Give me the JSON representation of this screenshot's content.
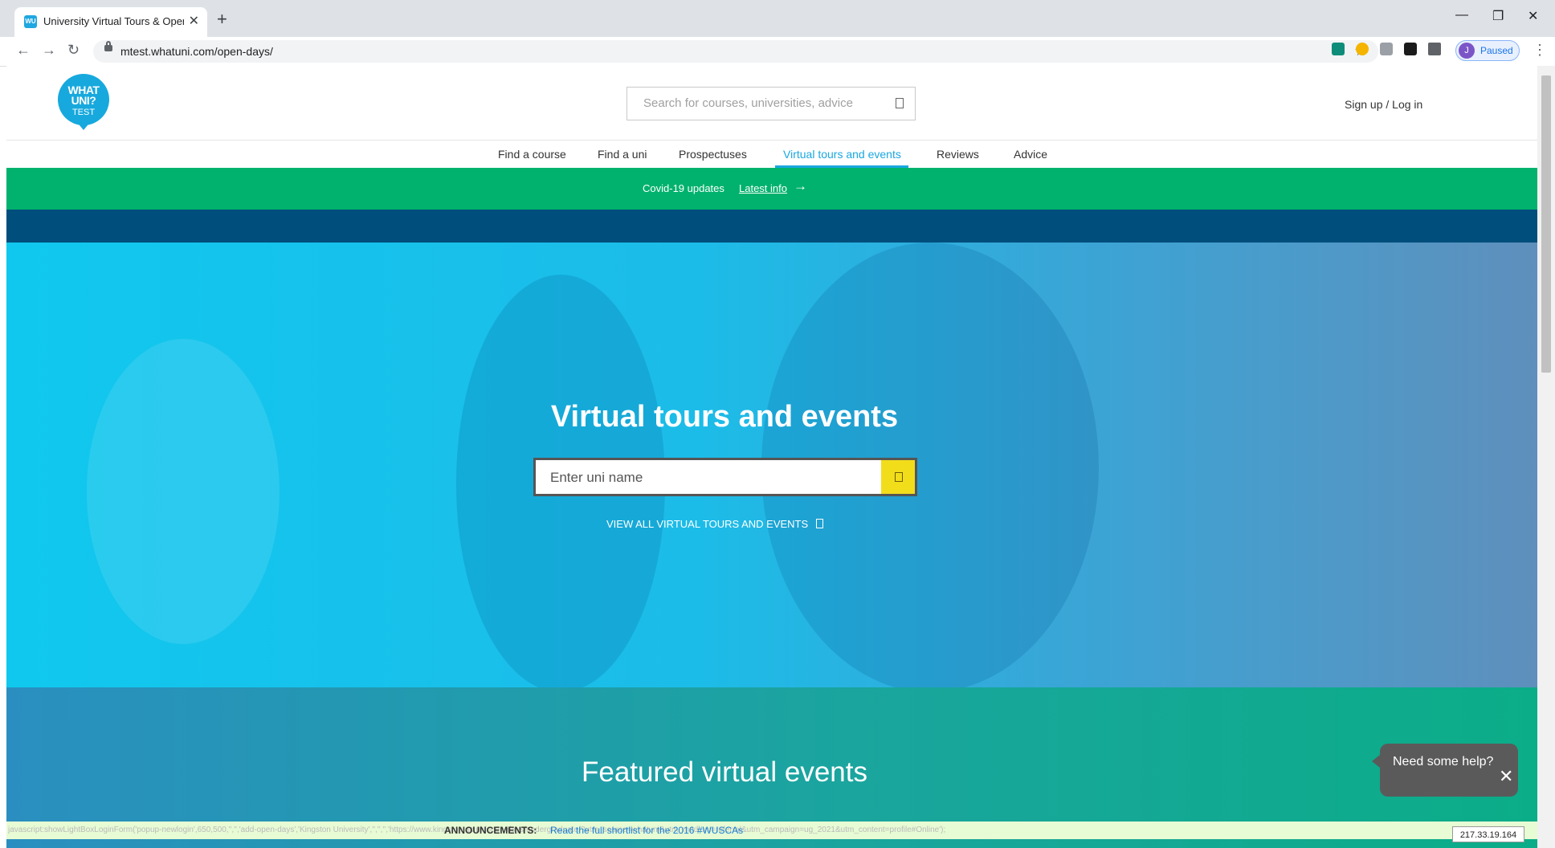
{
  "browser": {
    "tab_title": "University Virtual Tours & Open Days",
    "favicon_text": "WU",
    "url": "mtest.whatuni.com/open-days/",
    "profile_initial": "J",
    "profile_status": "Paused"
  },
  "header": {
    "logo_line1": "WHAT",
    "logo_line2": "UNI?",
    "logo_line3": "TEST",
    "search_placeholder": "Search for courses, universities, advice",
    "signin": "Sign up / Log in"
  },
  "nav": {
    "items": [
      "Find a course",
      "Find a uni",
      "Prospectuses",
      "Virtual tours and events",
      "Reviews",
      "Advice"
    ]
  },
  "covid": {
    "text": "Covid-19 updates",
    "link": "Latest info"
  },
  "hero": {
    "title": "Virtual tours and events",
    "search_placeholder": "Enter uni name",
    "view_all": "VIEW ALL VIRTUAL TOURS AND EVENTS"
  },
  "featured": {
    "title": "Featured virtual events"
  },
  "help": {
    "label": "Need some help?"
  },
  "announcement": {
    "status_url": "javascript:showLightBoxLoginForm('popup-newlogin',650,500,'','','add-open-days','Kingston University','','','','https://www.kingston.ac.uk/open-days/undergraduate/?utm_source=whatuni&utm_medium=referral&utm_campaign=ug_2021&utm_content=profile#Online');",
    "label": "ANNOUNCEMENTS:",
    "link": "Read the full shortlist for the 2016 #WUSCAs"
  },
  "ip_address": "217.33.19.164",
  "colors": {
    "brand_blue": "#1aa7e0",
    "covid_green": "#00b26d",
    "dark_band": "#004e7c",
    "search_button_yellow": "#f2dd1b"
  }
}
